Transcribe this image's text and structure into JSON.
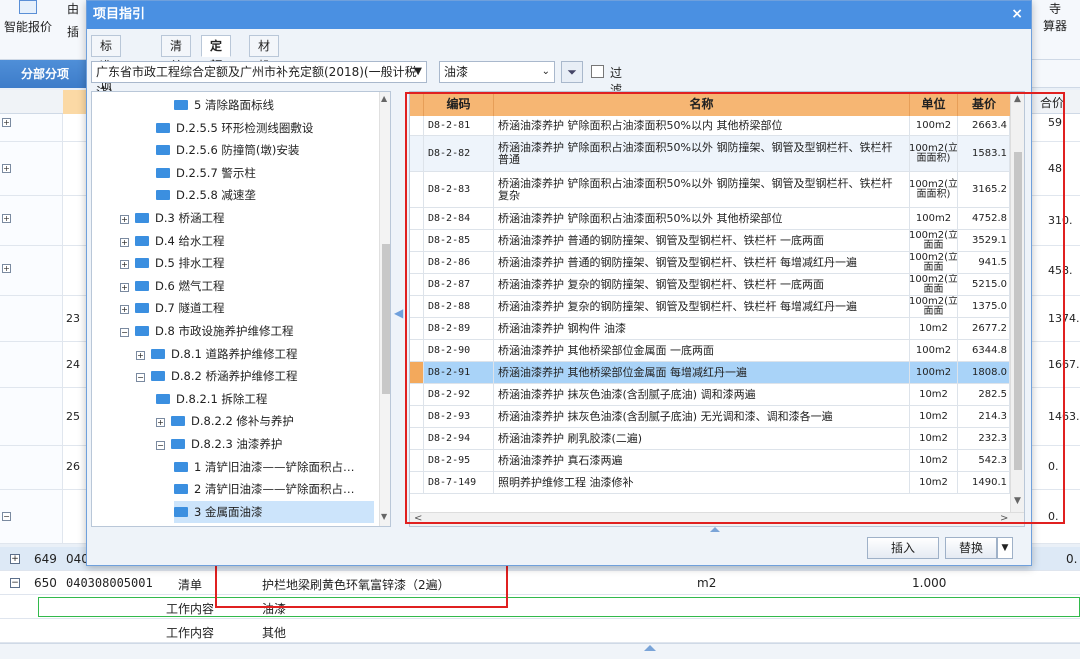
{
  "app": {
    "toolbar": {
      "smart_quote": "智能报价",
      "partial_1": "插",
      "partial_2": "由",
      "partial_right_1": "算器",
      "partial_right_top": "寺"
    },
    "tab_active": "分部分项",
    "grid_sum_header": "合价"
  },
  "bg_rows": [
    {
      "num": "",
      "val": "59."
    },
    {
      "num": "",
      "val": "48."
    },
    {
      "num": "",
      "val": "310."
    },
    {
      "num": "",
      "val": "458."
    },
    {
      "num": "23",
      "val": "1374."
    },
    {
      "num": "24",
      "val": "1667."
    },
    {
      "num": "25",
      "val": "1463."
    },
    {
      "num": "26",
      "val": "0."
    },
    {
      "num": "",
      "val": "0."
    }
  ],
  "bottom_rows": {
    "row649": {
      "idx": "649",
      "code": "040",
      "val": "0."
    },
    "row650": {
      "idx": "650",
      "code": "040308005001",
      "type": "清单",
      "name": "护栏地梁刷黄色环氧富锌漆（2遍）",
      "unit": "m2",
      "qty": "1.000"
    },
    "work1": {
      "label": "工作内容",
      "value": "油漆"
    },
    "work2": {
      "label": "工作内容",
      "value": "其他"
    }
  },
  "dialog": {
    "title": "项目指引",
    "close": "×",
    "tabs": [
      "标准项目",
      "清单",
      "定额",
      "材机"
    ],
    "active_tab": 2,
    "quota_select": "广东省市政工程综合定额及广州市补充定额(2018)(一般计税法)",
    "keyword_select": "油漆",
    "filter_label": "过滤",
    "insert_button": "插入",
    "replace_button": "替换"
  },
  "tree": [
    {
      "indent": 3,
      "label": "5 清除路面标线",
      "exp": ""
    },
    {
      "indent": 2,
      "label": "D.2.5.5 环形检测线圈敷设",
      "exp": ""
    },
    {
      "indent": 2,
      "label": "D.2.5.6 防撞筒(墩)安装",
      "exp": ""
    },
    {
      "indent": 2,
      "label": "D.2.5.7 警示柱",
      "exp": ""
    },
    {
      "indent": 2,
      "label": "D.2.5.8 减速垄",
      "exp": ""
    },
    {
      "indent": 0,
      "label": "D.3 桥涵工程",
      "exp": "+"
    },
    {
      "indent": 0,
      "label": "D.4 给水工程",
      "exp": "+"
    },
    {
      "indent": 0,
      "label": "D.5 排水工程",
      "exp": "+"
    },
    {
      "indent": 0,
      "label": "D.6 燃气工程",
      "exp": "+"
    },
    {
      "indent": 0,
      "label": "D.7 隧道工程",
      "exp": "+"
    },
    {
      "indent": 0,
      "label": "D.8 市政设施养护维修工程",
      "exp": "-"
    },
    {
      "indent": 1,
      "label": "D.8.1 道路养护维修工程",
      "exp": "+"
    },
    {
      "indent": 1,
      "label": "D.8.2 桥涵养护维修工程",
      "exp": "-"
    },
    {
      "indent": 2,
      "label": "D.8.2.1 拆除工程",
      "exp": ""
    },
    {
      "indent": 2,
      "label": "D.8.2.2 修补与养护",
      "exp": "+"
    },
    {
      "indent": 2,
      "label": "D.8.2.3 油漆养护",
      "exp": "-"
    },
    {
      "indent": 3,
      "label": "1 清铲旧油漆——铲除面积占…",
      "exp": ""
    },
    {
      "indent": 3,
      "label": "2 清铲旧油漆——铲除面积占…",
      "exp": ""
    },
    {
      "indent": 3,
      "label": "3 金属面油漆",
      "exp": "",
      "selected": true
    }
  ],
  "table": {
    "headers": {
      "code": "编码",
      "name": "名称",
      "unit": "单位",
      "price": "基价"
    },
    "rows": [
      {
        "code": "D8-2-81",
        "name": "桥涵油漆养护 铲除面积占油漆面积50%以内 其他桥梁部位",
        "unit": "100m2",
        "price": "2663.4"
      },
      {
        "code": "D8-2-82",
        "name": "桥涵油漆养护 铲除面积占油漆面积50%以外 钢防撞架、钢管及型钢栏杆、铁栏杆 普通",
        "unit": "100m2(立面面积)",
        "price": "1583.1"
      },
      {
        "code": "D8-2-83",
        "name": "桥涵油漆养护 铲除面积占油漆面积50%以外 钢防撞架、钢管及型钢栏杆、铁栏杆 复杂",
        "unit": "100m2(立面面积)",
        "price": "3165.2"
      },
      {
        "code": "D8-2-84",
        "name": "桥涵油漆养护 铲除面积占油漆面积50%以外 其他桥梁部位",
        "unit": "100m2",
        "price": "4752.8"
      },
      {
        "code": "D8-2-85",
        "name": "桥涵油漆养护 普通的钢防撞架、钢管及型钢栏杆、铁栏杆 一底两面",
        "unit": "100m2(立面面",
        "price": "3529.1"
      },
      {
        "code": "D8-2-86",
        "name": "桥涵油漆养护 普通的钢防撞架、钢管及型钢栏杆、铁栏杆 每增减红丹一遍",
        "unit": "100m2(立面面",
        "price": "941.5"
      },
      {
        "code": "D8-2-87",
        "name": "桥涵油漆养护 复杂的钢防撞架、钢管及型钢栏杆、铁栏杆 一底两面",
        "unit": "100m2(立面面",
        "price": "5215.0"
      },
      {
        "code": "D8-2-88",
        "name": "桥涵油漆养护 复杂的钢防撞架、钢管及型钢栏杆、铁栏杆 每增减红丹一遍",
        "unit": "100m2(立面面",
        "price": "1375.0"
      },
      {
        "code": "D8-2-89",
        "name": "桥涵油漆养护 钢构件 油漆",
        "unit": "10m2",
        "price": "2677.2"
      },
      {
        "code": "D8-2-90",
        "name": "桥涵油漆养护 其他桥梁部位金属面 一底两面",
        "unit": "100m2",
        "price": "6344.8"
      },
      {
        "code": "D8-2-91",
        "name": "桥涵油漆养护 其他桥梁部位金属面 每增减红丹一遍",
        "unit": "100m2",
        "price": "1808.0",
        "selected": true
      },
      {
        "code": "D8-2-92",
        "name": "桥涵油漆养护 抹灰色油漆(含刮腻子底油) 调和漆两遍",
        "unit": "10m2",
        "price": "282.5"
      },
      {
        "code": "D8-2-93",
        "name": "桥涵油漆养护 抹灰色油漆(含刮腻子底油) 无光调和漆、调和漆各一遍",
        "unit": "10m2",
        "price": "214.3"
      },
      {
        "code": "D8-2-94",
        "name": "桥涵油漆养护 刷乳胶漆(二遍)",
        "unit": "10m2",
        "price": "232.3"
      },
      {
        "code": "D8-2-95",
        "name": "桥涵油漆养护 真石漆两遍",
        "unit": "10m2",
        "price": "542.3"
      },
      {
        "code": "D8-7-149",
        "name": "照明养护维修工程 油漆修补",
        "unit": "10m2",
        "price": "1490.1"
      }
    ]
  },
  "colors": {
    "title_bar": "#4a90e2",
    "table_header": "#f6b673",
    "selected_row": "#a9d3f8",
    "highlight_box": "#e02020"
  }
}
